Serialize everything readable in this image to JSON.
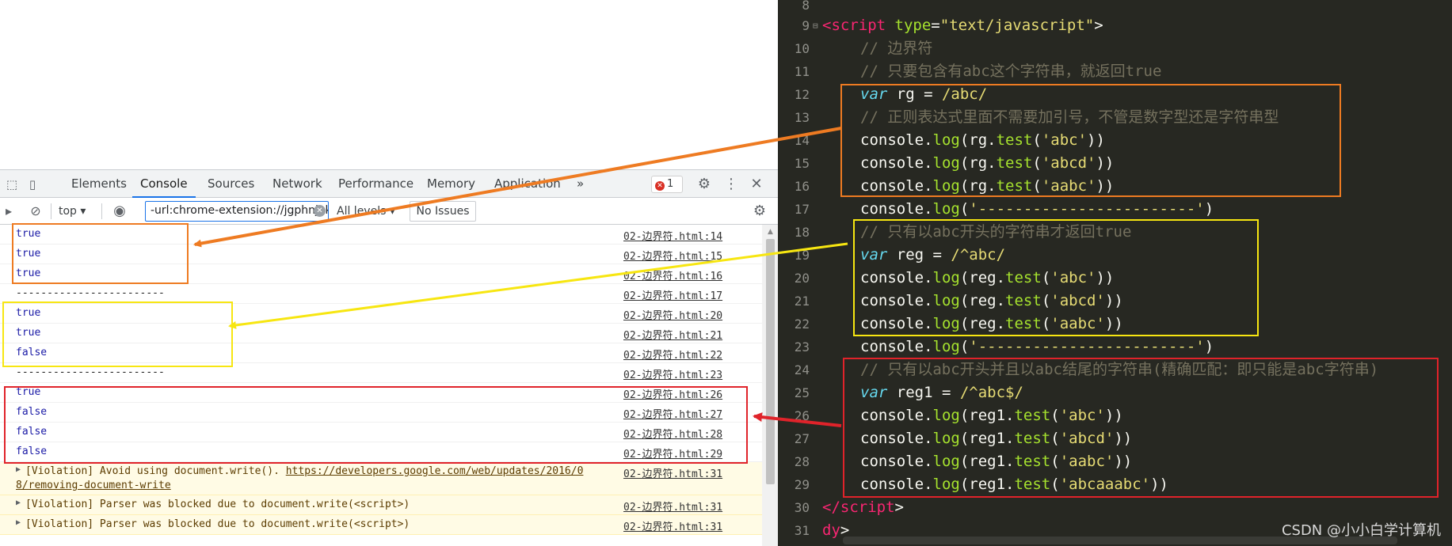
{
  "devtools": {
    "tabs": [
      "Elements",
      "Console",
      "Sources",
      "Network",
      "Performance",
      "Memory",
      "Application"
    ],
    "more_tabs": "»",
    "error_count": "1",
    "toolbar": {
      "context": "top",
      "filter_value": "-url:chrome-extension://jgphnjokjhjlcnnajmfjlacjnjkhleah",
      "levels": "All levels",
      "issues_label": "No Issues"
    }
  },
  "console": {
    "rows": [
      {
        "msg": "true",
        "src": "02-边界符.html:14"
      },
      {
        "msg": "true",
        "src": "02-边界符.html:15"
      },
      {
        "msg": "true",
        "src": "02-边界符.html:16"
      },
      {
        "msg": "------------------------",
        "src": "02-边界符.html:17"
      },
      {
        "msg": "true",
        "src": "02-边界符.html:20"
      },
      {
        "msg": "true",
        "src": "02-边界符.html:21"
      },
      {
        "msg": "false",
        "src": "02-边界符.html:22"
      },
      {
        "msg": "------------------------",
        "src": "02-边界符.html:23"
      },
      {
        "msg": "true",
        "src": "02-边界符.html:26"
      },
      {
        "msg": "false",
        "src": "02-边界符.html:27"
      },
      {
        "msg": "false",
        "src": "02-边界符.html:28"
      },
      {
        "msg": "false",
        "src": "02-边界符.html:29"
      }
    ],
    "warnings": [
      {
        "prefix": "[Violation] Avoid using document.write(). ",
        "link": "https://developers.google.com/web/updates/2016/0",
        "link2": "8/removing-document-write",
        "src": "02-边界符.html:31"
      },
      {
        "text": "[Violation] Parser was blocked due to document.write(<script>)",
        "src": "02-边界符.html:31"
      },
      {
        "text": "[Violation] Parser was blocked due to document.write(<script>)",
        "src": "02-边界符.html:31"
      }
    ]
  },
  "editor": {
    "line_numbers": [
      "8",
      "9",
      "10",
      "11",
      "12",
      "13",
      "14",
      "15",
      "16",
      "17",
      "18",
      "19",
      "20",
      "21",
      "22",
      "23",
      "24",
      "25",
      "26",
      "27",
      "28",
      "29",
      "30",
      "31"
    ],
    "comments": {
      "c10": "// 边界符",
      "c11": "// 只要包含有abc这个字符串，就返回true",
      "c13": "// 正则表达式里面不需要加引号，不管是数字型还是字符串型",
      "c18": "// 只有以abc开头的字符串才返回true",
      "c24": "// 只有以abc开头并且以abc结尾的字符串(精确匹配：即只能是abc字符串)"
    },
    "watermark": "CSDN @小小白学计算机"
  },
  "annotations": {
    "colors": {
      "orange": "#ee7b22",
      "yellow": "#f7e611",
      "red": "#e0232a"
    }
  }
}
